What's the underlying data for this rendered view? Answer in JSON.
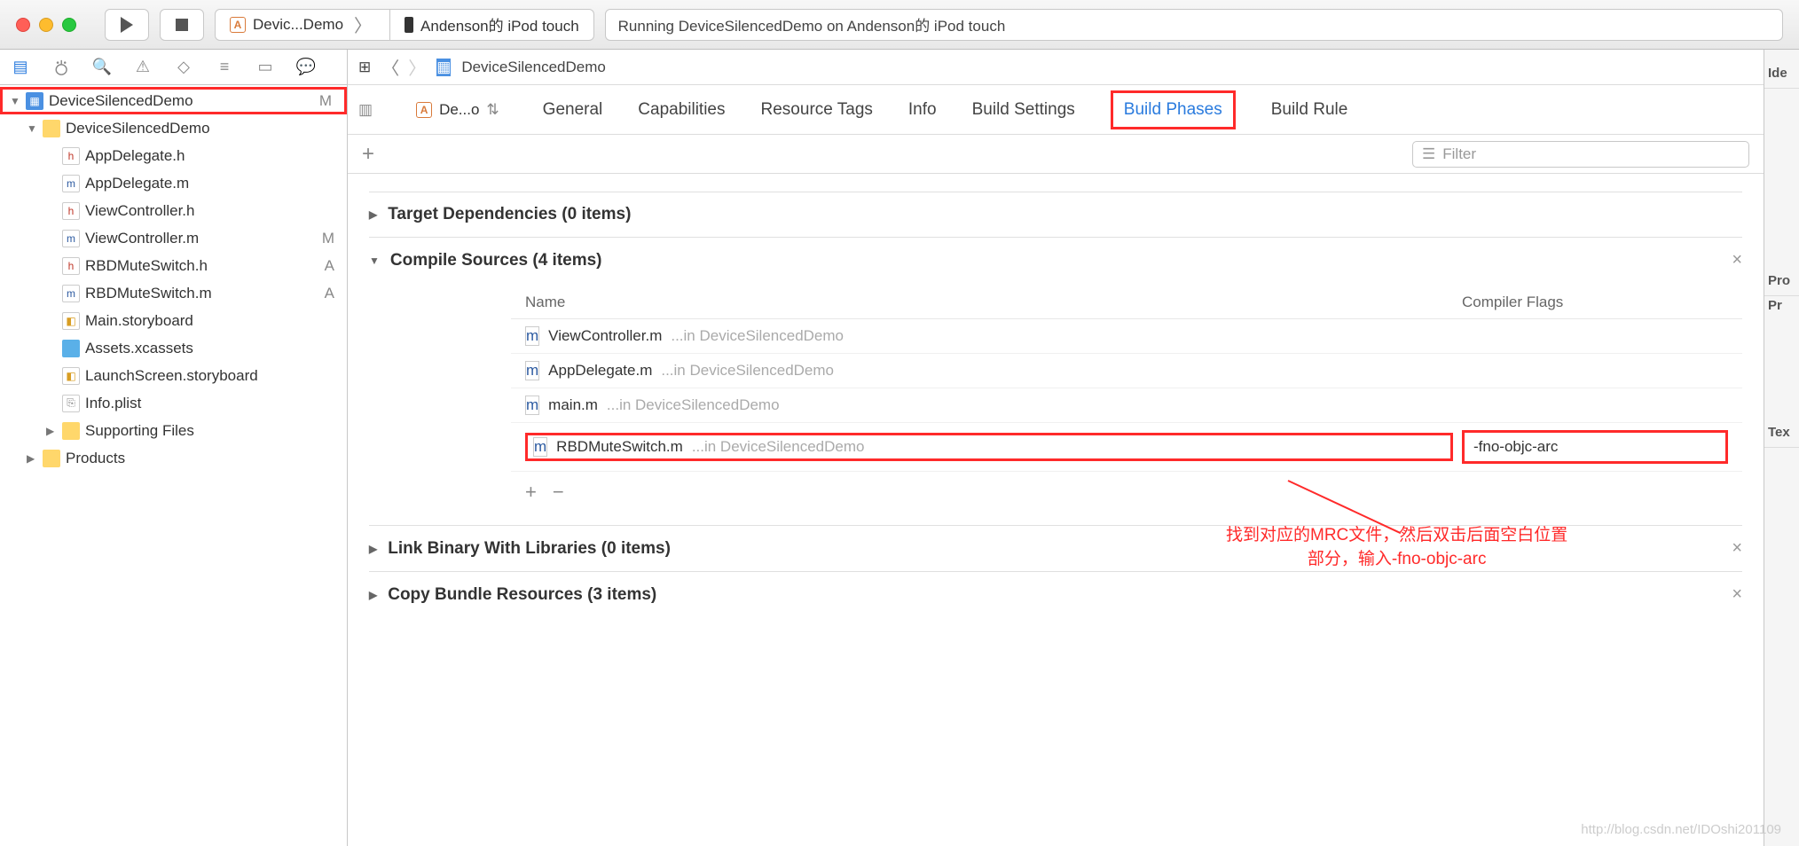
{
  "toolbar": {
    "scheme_app": "Devic...Demo",
    "scheme_device": "Andenson的 iPod touch",
    "status": "Running DeviceSilencedDemo on Andenson的 iPod touch"
  },
  "navigator": {
    "project": {
      "name": "DeviceSilencedDemo",
      "status": "M"
    },
    "tree": [
      {
        "indent": 1,
        "icon": "folder",
        "name": "DeviceSilencedDemo",
        "disclosure": "▼"
      },
      {
        "indent": 2,
        "icon": "h",
        "name": "AppDelegate.h"
      },
      {
        "indent": 2,
        "icon": "m",
        "name": "AppDelegate.m"
      },
      {
        "indent": 2,
        "icon": "h",
        "name": "ViewController.h"
      },
      {
        "indent": 2,
        "icon": "m",
        "name": "ViewController.m",
        "status": "M"
      },
      {
        "indent": 2,
        "icon": "h",
        "name": "RBDMuteSwitch.h",
        "status": "A"
      },
      {
        "indent": 2,
        "icon": "m",
        "name": "RBDMuteSwitch.m",
        "status": "A"
      },
      {
        "indent": 2,
        "icon": "sb",
        "name": "Main.storyboard"
      },
      {
        "indent": 2,
        "icon": "assets",
        "name": "Assets.xcassets"
      },
      {
        "indent": 2,
        "icon": "sb",
        "name": "LaunchScreen.storyboard"
      },
      {
        "indent": 2,
        "icon": "plist",
        "name": "Info.plist"
      },
      {
        "indent": 2,
        "icon": "folder",
        "name": "Supporting Files",
        "disclosure": "▶"
      },
      {
        "indent": 1,
        "icon": "folder",
        "name": "Products",
        "disclosure": "▶"
      }
    ]
  },
  "breadcrumb": {
    "project": "DeviceSilencedDemo"
  },
  "target_selector": "De...o",
  "tabs": [
    "General",
    "Capabilities",
    "Resource Tags",
    "Info",
    "Build Settings",
    "Build Phases",
    "Build Rule"
  ],
  "active_tab": "Build Phases",
  "filter_placeholder": "Filter",
  "phases": {
    "target_deps": "Target Dependencies (0 items)",
    "compile_sources": "Compile Sources (4 items)",
    "link_binary": "Link Binary With Libraries (0 items)",
    "copy_bundle": "Copy Bundle Resources (3 items)"
  },
  "compile_table": {
    "name_header": "Name",
    "flags_header": "Compiler Flags",
    "rows": [
      {
        "file": "ViewController.m",
        "path": "...in DeviceSilencedDemo",
        "flags": ""
      },
      {
        "file": "AppDelegate.m",
        "path": "...in DeviceSilencedDemo",
        "flags": ""
      },
      {
        "file": "main.m",
        "path": "...in DeviceSilencedDemo",
        "flags": ""
      },
      {
        "file": "RBDMuteSwitch.m",
        "path": "...in DeviceSilencedDemo",
        "flags": "-fno-objc-arc"
      }
    ]
  },
  "annotation": {
    "line1": "找到对应的MRC文件，然后双击后面空白位置",
    "line2": "部分，输入-fno-objc-arc"
  },
  "utilities": {
    "ide": "Ide",
    "pro": "Pro",
    "pr": "Pr",
    "tex": "Tex"
  },
  "watermark": "http://blog.csdn.net/IDOshi201109"
}
